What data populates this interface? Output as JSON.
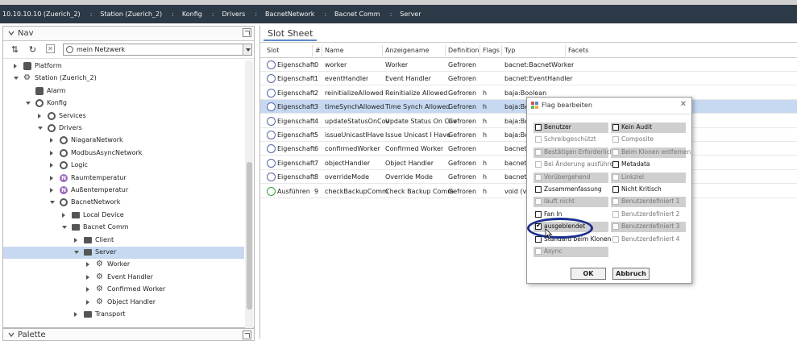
{
  "breadcrumb": [
    "10.10.10.10 (Zuerich_2)",
    "Station (Zuerich_2)",
    "Konfig",
    "Drivers",
    "BacnetNetwork",
    "Bacnet Comm",
    "Server"
  ],
  "nav": {
    "title": "Nav",
    "network_selector": "mein Netzwerk",
    "tree": [
      {
        "label": "Platform",
        "depth": 1,
        "twisty": "right",
        "icon": "platform-icon"
      },
      {
        "label": "Station (Zuerich_2)",
        "depth": 1,
        "twisty": "down",
        "icon": "station-icon"
      },
      {
        "label": "Alarm",
        "depth": 2,
        "twisty": "",
        "icon": "alarm-icon"
      },
      {
        "label": "Konfig",
        "depth": 2,
        "twisty": "down",
        "icon": "config-icon"
      },
      {
        "label": "Services",
        "depth": 3,
        "twisty": "right",
        "icon": "services-icon"
      },
      {
        "label": "Drivers",
        "depth": 3,
        "twisty": "down",
        "icon": "drivers-icon"
      },
      {
        "label": "NiagaraNetwork",
        "depth": 4,
        "twisty": "right",
        "icon": "network-icon"
      },
      {
        "label": "ModbusAsyncNetwork",
        "depth": 4,
        "twisty": "right",
        "icon": "network-icon"
      },
      {
        "label": "Logic",
        "depth": 4,
        "twisty": "right",
        "icon": "logic-icon"
      },
      {
        "label": "Raumtemperatur",
        "depth": 4,
        "twisty": "right",
        "icon": "numeric-icon"
      },
      {
        "label": "Außentemperatur",
        "depth": 4,
        "twisty": "right",
        "icon": "numeric-icon"
      },
      {
        "label": "BacnetNetwork",
        "depth": 4,
        "twisty": "down",
        "icon": "network-icon"
      },
      {
        "label": "Local Device",
        "depth": 5,
        "twisty": "right",
        "icon": "folder-icon"
      },
      {
        "label": "Bacnet Comm",
        "depth": 5,
        "twisty": "down",
        "icon": "folder-icon"
      },
      {
        "label": "Client",
        "depth": 6,
        "twisty": "right",
        "icon": "folder-icon"
      },
      {
        "label": "Server",
        "depth": 6,
        "twisty": "down",
        "icon": "folder-icon",
        "selected": true
      },
      {
        "label": "Worker",
        "depth": 7,
        "twisty": "right",
        "icon": "gears-icon"
      },
      {
        "label": "Event Handler",
        "depth": 7,
        "twisty": "right",
        "icon": "gears-icon"
      },
      {
        "label": "Confirmed Worker",
        "depth": 7,
        "twisty": "right",
        "icon": "gears-icon"
      },
      {
        "label": "Object Handler",
        "depth": 7,
        "twisty": "right",
        "icon": "gears-icon"
      },
      {
        "label": "Transport",
        "depth": 6,
        "twisty": "right",
        "icon": "folder-icon"
      }
    ]
  },
  "palette": {
    "title": "Palette"
  },
  "slot_sheet": {
    "tab": "Slot Sheet",
    "columns": [
      "Slot",
      "#",
      "Name",
      "Anzeigename",
      "Definition",
      "Flags",
      "Typ",
      "Facets"
    ],
    "rows": [
      {
        "slot": "Eigenschaft",
        "num": "0",
        "name": "worker",
        "display": "Worker",
        "def": "Gefroren",
        "flags": "",
        "type": "bacnet:BacnetWorker"
      },
      {
        "slot": "Eigenschaft",
        "num": "1",
        "name": "eventHandler",
        "display": "Event Handler",
        "def": "Gefroren",
        "flags": "",
        "type": "bacnet:EventHandler"
      },
      {
        "slot": "Eigenschaft",
        "num": "2",
        "name": "reinitializeAllowed",
        "display": "Reinitialize Allowed",
        "def": "Gefroren",
        "flags": "h",
        "type": "baja:Boolean"
      },
      {
        "slot": "Eigenschaft",
        "num": "3",
        "name": "timeSynchAllowed",
        "display": "Time Synch Allowed",
        "def": "Gefroren",
        "flags": "h",
        "type": "baja:Boo",
        "selected": true
      },
      {
        "slot": "Eigenschaft",
        "num": "4",
        "name": "updateStatusOnCov",
        "display": "Update Status On Cov",
        "def": "Gefroren",
        "flags": "h",
        "type": "baja:Boo"
      },
      {
        "slot": "Eigenschaft",
        "num": "5",
        "name": "issueUnicastIHave",
        "display": "Issue Unicast I Have",
        "def": "Gefroren",
        "flags": "h",
        "type": "baja:Boo"
      },
      {
        "slot": "Eigenschaft",
        "num": "6",
        "name": "confirmedWorker",
        "display": "Confirmed Worker",
        "def": "Gefroren",
        "flags": "",
        "type": "bacnet:B"
      },
      {
        "slot": "Eigenschaft",
        "num": "7",
        "name": "objectHandler",
        "display": "Object Handler",
        "def": "Gefroren",
        "flags": "h",
        "type": "bacnet:O"
      },
      {
        "slot": "Eigenschaft",
        "num": "8",
        "name": "overrideMode",
        "display": "Override Mode",
        "def": "Gefroren",
        "flags": "h",
        "type": "bacnet:O"
      },
      {
        "slot": "Ausführen",
        "num": "9",
        "name": "checkBackupComm",
        "display": "Check Backup Comm",
        "def": "Gefroren",
        "flags": "h",
        "type": "void (voi",
        "action": true
      }
    ]
  },
  "dialog": {
    "title": "Flag bearbeiten",
    "ok": "OK",
    "cancel": "Abbruch",
    "left_flags": [
      {
        "label": "Benutzer",
        "state": "enb",
        "checked": false
      },
      {
        "label": "Schreibgeschützt",
        "state": "dis-white",
        "checked": false
      },
      {
        "label": "Bestätigen Erforderlich",
        "state": "dis",
        "checked": false
      },
      {
        "label": "Bei Änderung ausführen",
        "state": "dis-white",
        "checked": false
      },
      {
        "label": "Vorübergehend",
        "state": "dis",
        "checked": false
      },
      {
        "label": "Zusammenfassung",
        "state": "en",
        "checked": false
      },
      {
        "label": "läuft nicht",
        "state": "dis",
        "checked": false
      },
      {
        "label": "Fan In",
        "state": "en",
        "checked": false
      },
      {
        "label": "ausgeblendet",
        "state": "enb",
        "checked": true
      },
      {
        "label": "Standard beim Klonen",
        "state": "en",
        "checked": false
      },
      {
        "label": "Async",
        "state": "dis",
        "checked": false
      }
    ],
    "right_flags": [
      {
        "label": "Kein Audit",
        "state": "enb",
        "checked": false
      },
      {
        "label": "Composite",
        "state": "dis-white",
        "checked": false
      },
      {
        "label": "Beim Klonen entfernen",
        "state": "dis",
        "checked": false
      },
      {
        "label": "Metadata",
        "state": "en",
        "checked": false
      },
      {
        "label": "Linkziel",
        "state": "dis",
        "checked": false
      },
      {
        "label": "Nicht Kritisch",
        "state": "en",
        "checked": false
      },
      {
        "label": "Benutzerdefiniert 1",
        "state": "dis",
        "checked": false
      },
      {
        "label": "Benutzerdefiniert 2",
        "state": "dis-white",
        "checked": false
      },
      {
        "label": "Benutzerdefiniert 3",
        "state": "dis",
        "checked": false
      },
      {
        "label": "Benutzerdefiniert 4",
        "state": "dis-white",
        "checked": false
      }
    ]
  }
}
